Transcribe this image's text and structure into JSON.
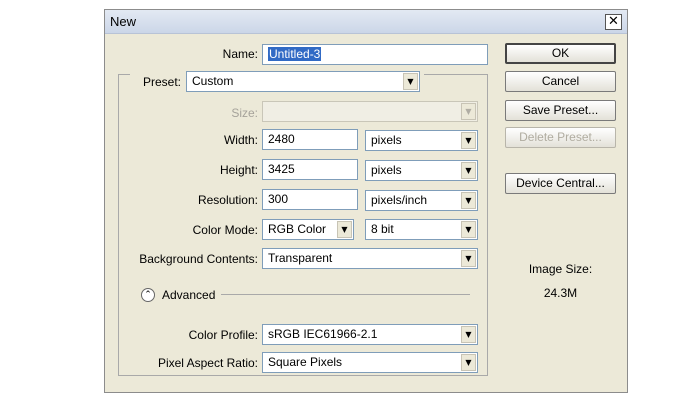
{
  "window": {
    "title": "New",
    "close_glyph": "✕"
  },
  "name": {
    "label": "Name:",
    "value": "Untitled-3"
  },
  "preset": {
    "label": "Preset:",
    "value": "Custom"
  },
  "size": {
    "label": "Size:",
    "value": ""
  },
  "width": {
    "label": "Width:",
    "value": "2480",
    "unit": "pixels"
  },
  "height": {
    "label": "Height:",
    "value": "3425",
    "unit": "pixels"
  },
  "resolution": {
    "label": "Resolution:",
    "value": "300",
    "unit": "pixels/inch"
  },
  "color_mode": {
    "label": "Color Mode:",
    "value": "RGB Color",
    "depth": "8 bit"
  },
  "background": {
    "label": "Background Contents:",
    "value": "Transparent"
  },
  "advanced": {
    "label": "Advanced",
    "toggle_glyph": "⌃"
  },
  "color_profile": {
    "label": "Color Profile:",
    "value": "sRGB IEC61966-2.1"
  },
  "pixel_aspect": {
    "label": "Pixel Aspect Ratio:",
    "value": "Square Pixels"
  },
  "buttons": {
    "ok": "OK",
    "cancel": "Cancel",
    "save_preset": "Save Preset...",
    "delete_preset": "Delete Preset...",
    "device_central": "Device Central..."
  },
  "image_size": {
    "label": "Image Size:",
    "value": "24.3M"
  },
  "icons": {
    "dropdown": "triangle-down-icon",
    "close": "close-icon",
    "collapse": "chevron-up-icon"
  },
  "dropdown_glyph": "▼"
}
